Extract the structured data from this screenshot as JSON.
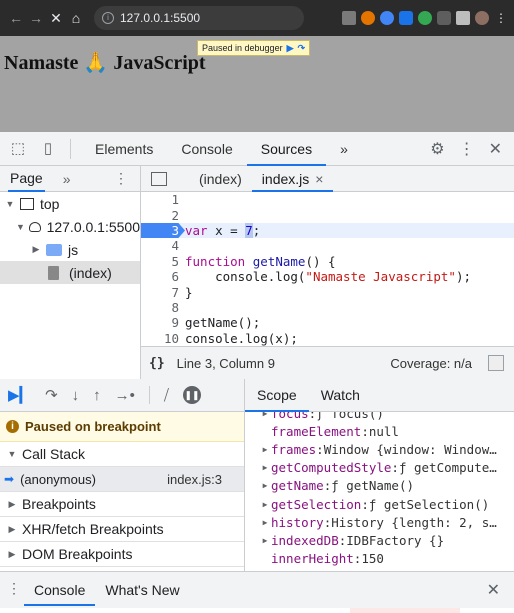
{
  "browser": {
    "url": "127.0.0.1:5500",
    "info_icon": "info-icon"
  },
  "page": {
    "heading": "Namaste 🙏 JavaScript",
    "paused_label": "Paused in debugger"
  },
  "devtools": {
    "tabs": [
      "Elements",
      "Console",
      "Sources"
    ],
    "active_tab": "Sources",
    "more_tabs": "»"
  },
  "navigator": {
    "tab_label": "Page",
    "more": "»",
    "tree": [
      {
        "label": "top"
      },
      {
        "label": "127.0.0.1:5500"
      },
      {
        "label": "js"
      },
      {
        "label": "(index)"
      }
    ]
  },
  "editor": {
    "tabs": [
      "(index)",
      "index.js"
    ],
    "active_tab": "index.js",
    "close_icon": "×",
    "lines": [
      {
        "n": "1"
      },
      {
        "n": "2"
      },
      {
        "n": "3"
      },
      {
        "n": "4"
      },
      {
        "n": "5"
      },
      {
        "n": "6"
      },
      {
        "n": "7"
      },
      {
        "n": "8"
      },
      {
        "n": "9"
      },
      {
        "n": "10"
      }
    ],
    "code": {
      "l3_kw": "var",
      "l3_rest": " x = ",
      "l3_num": "7",
      "l3_end": ";",
      "l5_kw": "function",
      "l5_fn": " getName",
      "l5_end": "() {",
      "l6_pre": "    console.log(",
      "l6_str": "\"Namaste Javascript\"",
      "l6_end": ");",
      "l7": "}",
      "l9": "getName();",
      "l10": "console.log(x);"
    }
  },
  "status": {
    "braces": "{}",
    "position": "Line 3, Column 9",
    "coverage": "Coverage: n/a"
  },
  "debugger": {
    "paused_message": "Paused on breakpoint",
    "call_stack_label": "Call Stack",
    "frame_name": "(anonymous)",
    "frame_location": "index.js:3",
    "sections": [
      "Breakpoints",
      "XHR/fetch Breakpoints",
      "DOM Breakpoints"
    ]
  },
  "scope": {
    "tabs": [
      "Scope",
      "Watch"
    ],
    "active_tab": "Scope",
    "items": [
      {
        "key": "focus",
        "val": "ƒ focus()",
        "expandable": true
      },
      {
        "key": "frameElement",
        "val": "null",
        "expandable": false
      },
      {
        "key": "frames",
        "val": "Window {window: Window…",
        "expandable": true
      },
      {
        "key": "getComputedStyle",
        "val": "ƒ getCompute…",
        "expandable": true
      },
      {
        "key": "getName",
        "val": "ƒ getName()",
        "expandable": true
      },
      {
        "key": "getSelection",
        "val": "ƒ getSelection()",
        "expandable": true
      },
      {
        "key": "history",
        "val": "History {length: 2, s…",
        "expandable": true
      },
      {
        "key": "indexedDB",
        "val": "IDBFactory {}",
        "expandable": true
      },
      {
        "key": "innerHeight",
        "val": "150",
        "expandable": false
      }
    ]
  },
  "drawer": {
    "tabs": [
      "Console",
      "What's New"
    ],
    "active_tab": "Console"
  }
}
